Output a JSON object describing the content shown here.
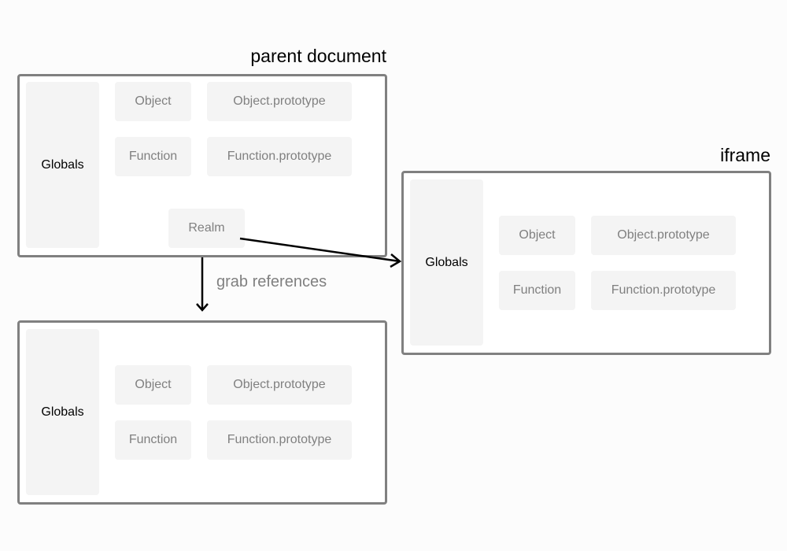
{
  "parent": {
    "title": "parent document",
    "globals": "Globals",
    "object": "Object",
    "object_prototype": "Object.prototype",
    "function": "Function",
    "function_prototype": "Function.prototype",
    "realm": "Realm"
  },
  "iframe": {
    "title": "iframe",
    "globals": "Globals",
    "object": "Object",
    "object_prototype": "Object.prototype",
    "function": "Function",
    "function_prototype": "Function.prototype"
  },
  "copy": {
    "globals": "Globals",
    "object": "Object",
    "object_prototype": "Object.prototype",
    "function": "Function",
    "function_prototype": "Function.prototype"
  },
  "arrow_label": "grab references",
  "colors": {
    "border": "#808080",
    "cell_bg": "#f4f4f4",
    "muted_text": "#808080",
    "arrow": "#000000"
  }
}
